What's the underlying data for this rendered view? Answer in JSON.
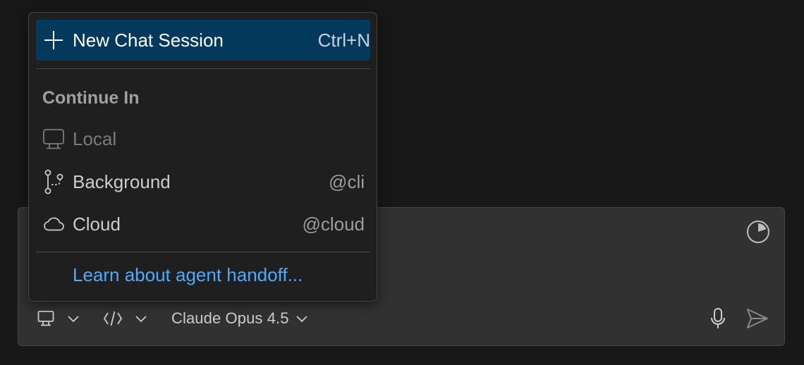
{
  "menu": {
    "new_chat": {
      "label": "New Chat Session",
      "shortcut": "Ctrl+N"
    },
    "section_title": "Continue In",
    "items": [
      {
        "label": "Local",
        "shortcut": "",
        "icon": "monitor-icon",
        "disabled": true
      },
      {
        "label": "Background",
        "shortcut": "@cli",
        "icon": "git-branch-icon",
        "disabled": false
      },
      {
        "label": "Cloud",
        "shortcut": "@cloud",
        "icon": "cloud-icon",
        "disabled": false
      }
    ],
    "learn_link": "Learn about agent handoff..."
  },
  "chat_input": {
    "model": "Claude Opus 4.5"
  },
  "colors": {
    "background": "#181818",
    "menu_background": "#1f1f1f",
    "selected_item": "#04395e",
    "link": "#4daafc",
    "input_background": "#313131"
  }
}
